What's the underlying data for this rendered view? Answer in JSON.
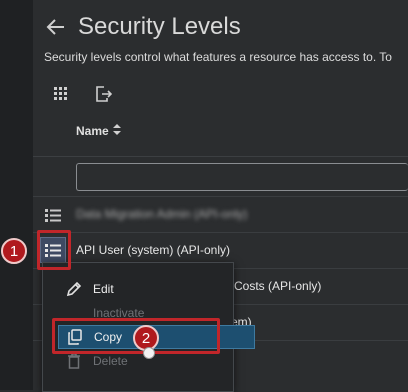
{
  "header": {
    "title": "Security Levels",
    "subtitle": "Security levels control what features a resource has access to. To"
  },
  "toolbar": {
    "grid_icon": "grid-icon",
    "export_icon": "export-icon"
  },
  "table": {
    "column_header": "Name",
    "sort_icon": "sort-icon",
    "filter_value": "",
    "rows": [
      {
        "label": "Data Migration Admin (API-only)",
        "blurred": true
      },
      {
        "label": "API User (system) (API-only)"
      },
      {
        "label": "Costs (API-only)"
      },
      {
        "label": "em)"
      },
      {
        "label": ""
      }
    ]
  },
  "context_menu": {
    "items": [
      {
        "label": "Edit",
        "icon": "pencil-icon",
        "enabled": true
      },
      {
        "label": "Inactivate",
        "icon": "",
        "enabled": false
      },
      {
        "label": "Copy",
        "icon": "copy-icon",
        "enabled": true,
        "highlighted": true
      },
      {
        "label": "Delete",
        "icon": "trash-icon",
        "enabled": false
      }
    ]
  },
  "callouts": [
    {
      "number": "1"
    },
    {
      "number": "2"
    }
  ],
  "colors": {
    "background": "#2b2d2f",
    "callout_red": "#c1262a",
    "highlight_blue": "#1d4f70"
  }
}
